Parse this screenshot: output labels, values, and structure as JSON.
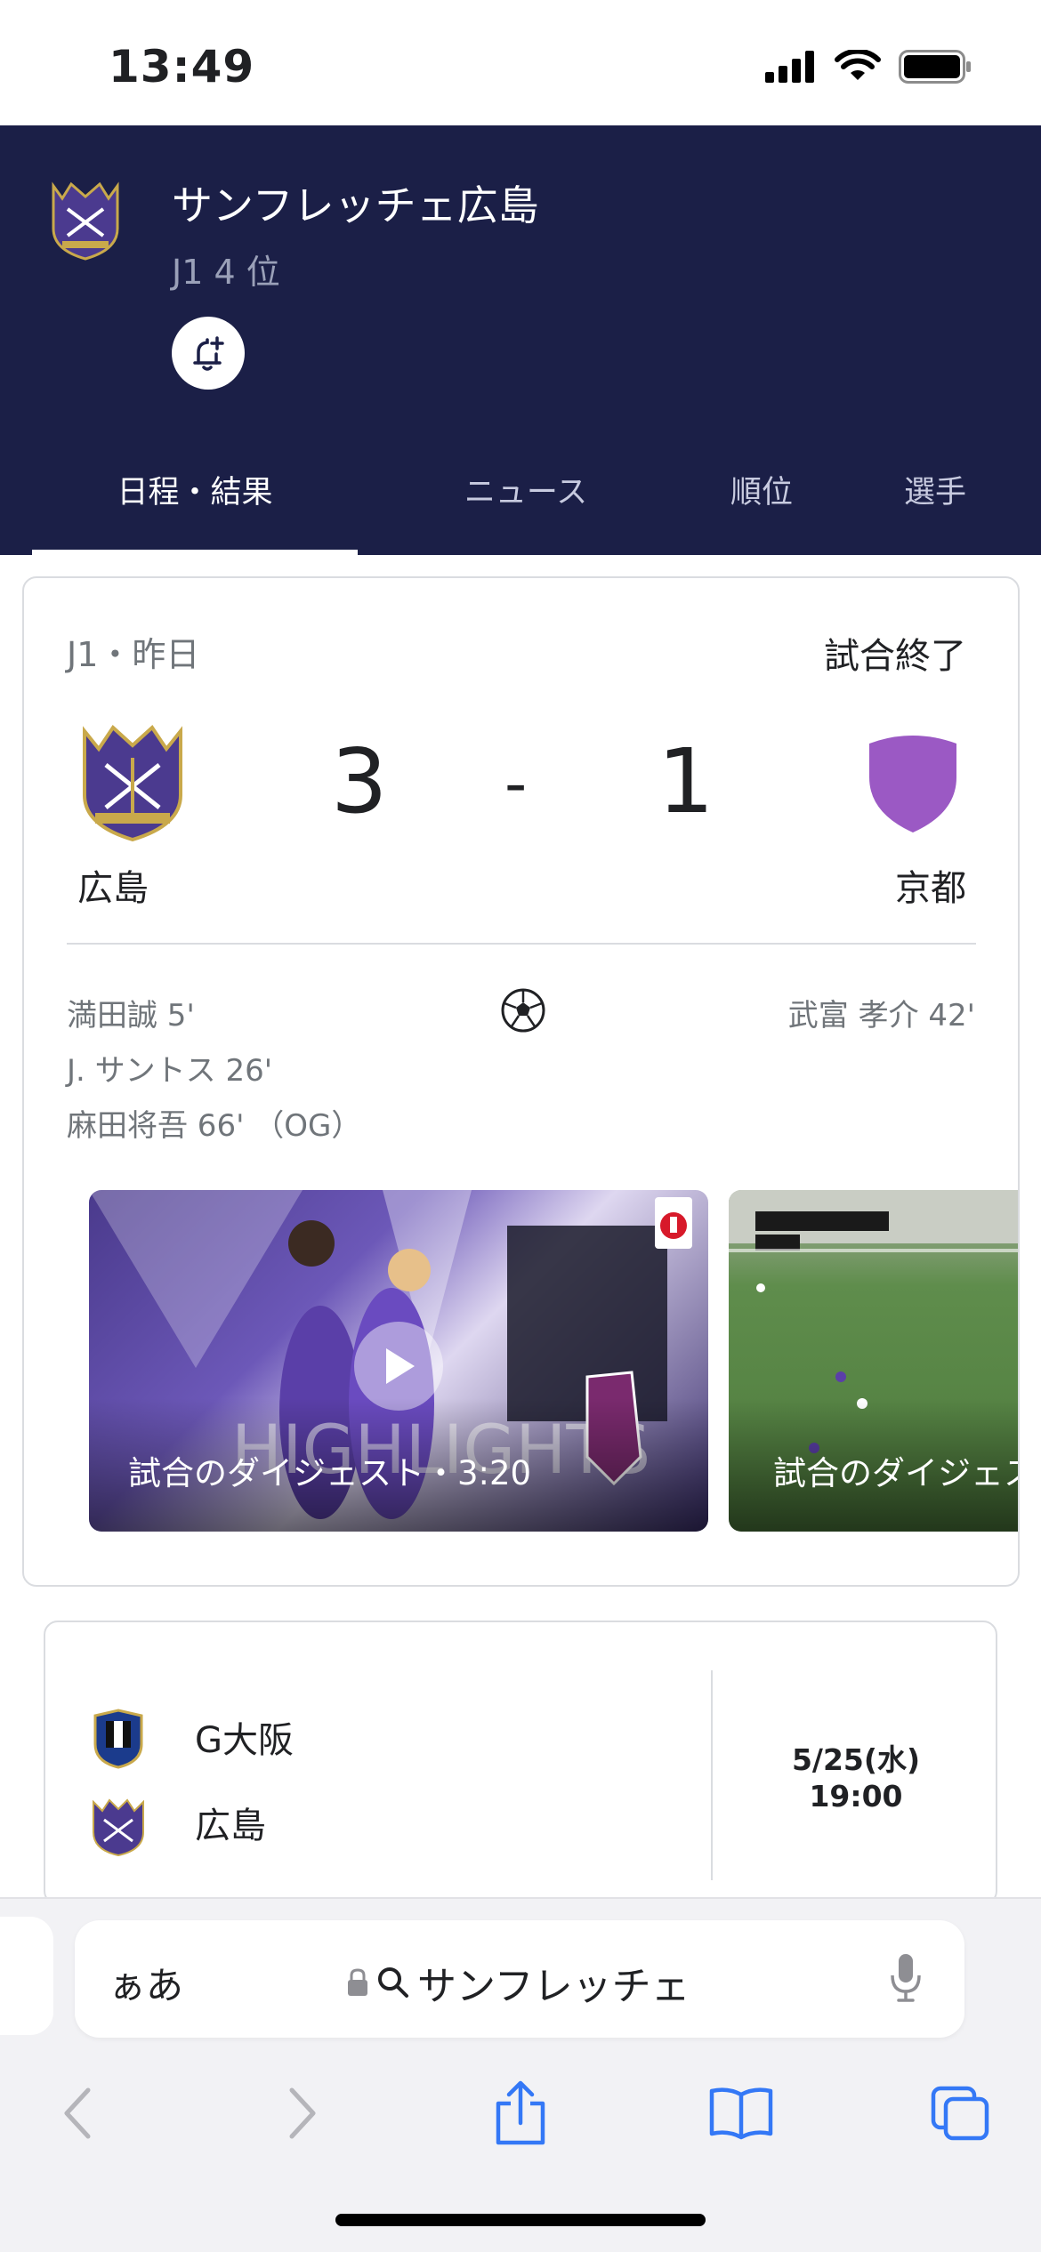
{
  "status_bar": {
    "time": "13:49"
  },
  "team": {
    "name": "サンフレッチェ広島",
    "rank": "J1 4 位"
  },
  "tabs": [
    {
      "label": "日程・結果",
      "active": true
    },
    {
      "label": "ニュース",
      "active": false
    },
    {
      "label": "順位",
      "active": false
    },
    {
      "label": "選手",
      "active": false
    }
  ],
  "match": {
    "competition": "J1・昨日",
    "status": "試合終了",
    "home": {
      "name": "広島",
      "score": "3"
    },
    "away": {
      "name": "京都",
      "score": "1"
    },
    "dash": "-",
    "home_goals": [
      "満田誠 5'",
      "J. サントス 26'",
      "麻田将吾 66' （OG）"
    ],
    "away_goals": [
      "武富 孝介 42'"
    ],
    "videos": [
      {
        "title": "試合のダイジェスト・3:20"
      },
      {
        "title": "試合のダイジェスト"
      }
    ]
  },
  "next_match": {
    "home": "G大阪",
    "away": "広島",
    "date": "5/25(水)",
    "time": "19:00"
  },
  "browser": {
    "aa_label": "ぁあ",
    "url_text": "サンフレッチェ"
  },
  "colors": {
    "header_bg": "#1b1f47",
    "sanfrecce_purple": "#4b3a8f",
    "kyoto_purple": "#9b59c4",
    "ios_blue": "#3478f6"
  }
}
